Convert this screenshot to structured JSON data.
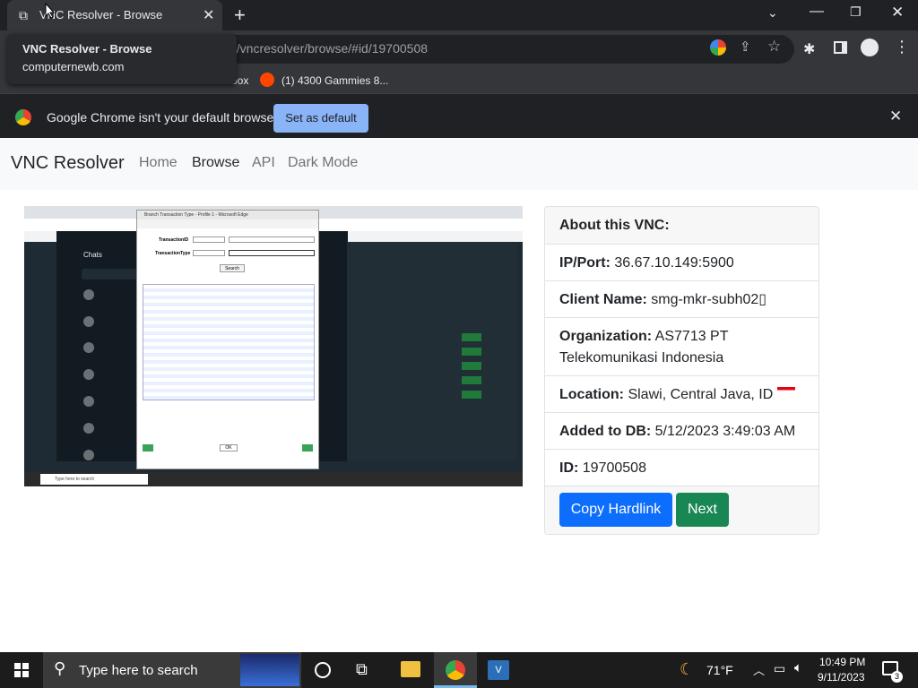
{
  "browser": {
    "tab_title": "VNC Resolver - Browse",
    "url_visible": "n/vncresolver/browse/#id/19700508",
    "bookmarks": [
      {
        "label": "box"
      },
      {
        "label": "(1) 4300 Gammies 8..."
      }
    ],
    "infobar": {
      "message": "Google Chrome isn't your default browser",
      "button": "Set as default"
    }
  },
  "tooltip": {
    "title": "VNC Resolver - Browse",
    "domain": "computernewb.com"
  },
  "nav": {
    "brand": "VNC Resolver",
    "links": [
      "Home",
      "Browse",
      "API",
      "Dark Mode"
    ]
  },
  "vnc_card": {
    "header": "About this VNC:",
    "rows": [
      {
        "label": "IP/Port:",
        "value": "36.67.10.149:5900"
      },
      {
        "label": "Client Name:",
        "value": "smg-mkr-subh02▯"
      },
      {
        "label": "Organization:",
        "value": "AS7713 PT Telekomunikasi Indonesia"
      },
      {
        "label": "Location:",
        "value": "Slawi, Central Java, ID"
      },
      {
        "label": "Added to DB:",
        "value": "5/12/2023 3:49:03 AM"
      },
      {
        "label": "ID:",
        "value": "19700508"
      }
    ],
    "buttons": {
      "hardlink": "Copy Hardlink",
      "next": "Next"
    }
  },
  "screenshot": {
    "dialog_title": "Branch Transaction Type - Profile 1 - Microsoft Edge",
    "chats_label": "Chats",
    "field1": "TransactionID",
    "field2": "TransactionType",
    "search": "Search",
    "ok": "OK",
    "taskbar_search": "Type here to search"
  },
  "taskbar": {
    "search_placeholder": "Type here to search",
    "weather": "71°F",
    "time": "10:49 PM",
    "date": "9/11/2023",
    "notification_count": "3"
  },
  "colors": {
    "primary": "#0d6efd",
    "success": "#198754",
    "chrome_dark": "#202124"
  }
}
